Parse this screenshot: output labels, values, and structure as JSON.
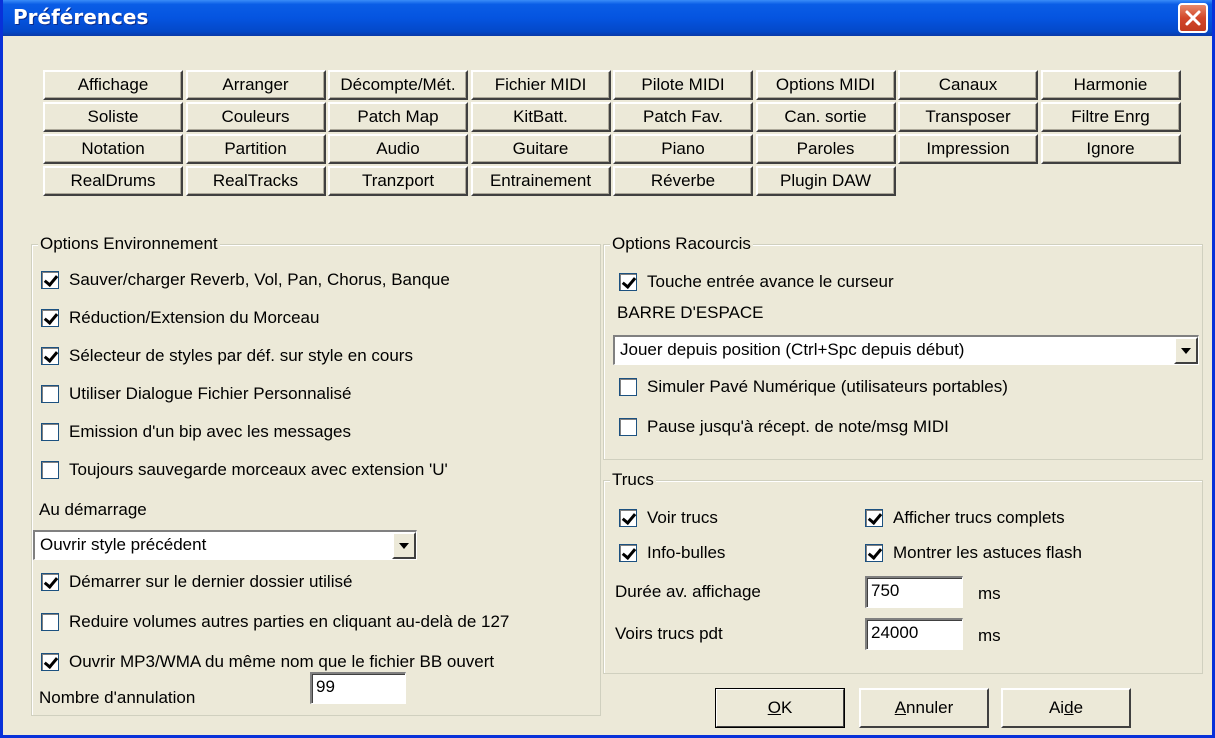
{
  "window": {
    "title": "Préférences"
  },
  "tabs": [
    [
      "Affichage",
      "Arranger",
      "Décompte/Mét.",
      "Fichier MIDI",
      "Pilote MIDI",
      "Options MIDI",
      "Canaux",
      "Harmonie"
    ],
    [
      "Soliste",
      "Couleurs",
      "Patch Map",
      "KitBatt.",
      "Patch Fav.",
      "Can. sortie",
      "Transposer",
      "Filtre Enrg"
    ],
    [
      "Notation",
      "Partition",
      "Audio",
      "Guitare",
      "Piano",
      "Paroles",
      "Impression",
      "Ignore"
    ],
    [
      "RealDrums",
      "RealTracks",
      "Tranzport",
      "Entrainement",
      "Réverbe",
      "Plugin DAW"
    ]
  ],
  "env": {
    "title": "Options Environnement",
    "options": [
      {
        "label": "Sauver/charger Reverb, Vol, Pan, Chorus, Banque",
        "checked": true
      },
      {
        "label": "Réduction/Extension du Morceau",
        "checked": true
      },
      {
        "label": "Sélecteur de styles par déf. sur style en cours",
        "checked": true
      },
      {
        "label": "Utiliser Dialogue Fichier Personnalisé",
        "checked": false
      },
      {
        "label": "Emission d'un bip avec les messages",
        "checked": false
      },
      {
        "label": "Toujours sauvegarde morceaux avec extension 'U'",
        "checked": false
      }
    ],
    "startup_label": "Au démarrage",
    "startup_value": "Ouvrir style précédent",
    "options2": [
      {
        "label": "Démarrer sur le dernier dossier utilisé",
        "checked": true
      },
      {
        "label": "Reduire volumes autres parties en cliquant au-delà de 127",
        "checked": false
      },
      {
        "label": "Ouvrir MP3/WMA du même nom que le fichier BB ouvert",
        "checked": true
      }
    ],
    "undo_label": "Nombre d'annulation",
    "undo_value": "99"
  },
  "shortcuts": {
    "title": "Options Racourcis",
    "enter_label": "Touche entrée avance le curseur",
    "enter_checked": true,
    "space_label": "BARRE D'ESPACE",
    "space_value": "Jouer depuis position (Ctrl+Spc depuis début)",
    "numpad_label": "Simuler Pavé Numérique (utilisateurs portables)",
    "numpad_checked": false,
    "pause_label": "Pause jusqu'à récept. de note/msg MIDI",
    "pause_checked": false
  },
  "tips": {
    "title": "Trucs",
    "show_tips": {
      "label": "Voir trucs",
      "checked": true
    },
    "tooltips": {
      "label": "Info-bulles",
      "checked": true
    },
    "full_tips": {
      "label": "Afficher trucs complets",
      "checked": true
    },
    "flash_tips": {
      "label": "Montrer les astuces flash",
      "checked": true
    },
    "duration_label": "Durée av. affichage",
    "duration_value": "750",
    "duration_unit": "ms",
    "show_for_label": "Voirs trucs pdt",
    "show_for_value": "24000",
    "show_for_unit": "ms"
  },
  "buttons": {
    "ok_mn": "O",
    "ok_rest": "K",
    "cancel_mn": "A",
    "cancel_rest": "nnuler",
    "help_a": "Ai",
    "help_mn": "d",
    "help_b": "e"
  },
  "icons": {
    "close": "close-icon",
    "dropdown": "chevron-down-icon"
  }
}
